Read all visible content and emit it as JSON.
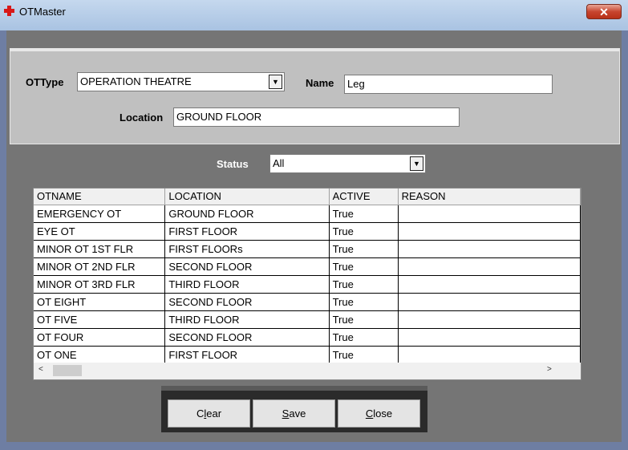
{
  "window": {
    "title": "OTMaster",
    "close_label": "✕"
  },
  "form": {
    "ottype_label": "OTType",
    "ottype_value": "OPERATION THEATRE",
    "name_label": "Name",
    "name_value": "Leg",
    "location_label": "Location",
    "location_value": "GROUND FLOOR",
    "status_label": "Status",
    "status_value": "All"
  },
  "grid": {
    "columns": [
      "OTNAME",
      "LOCATION",
      "ACTIVE",
      "REASON"
    ],
    "rows": [
      [
        "EMERGENCY OT",
        "GROUND FLOOR",
        "True",
        ""
      ],
      [
        "EYE OT",
        "FIRST FLOOR",
        "True",
        ""
      ],
      [
        "MINOR OT 1ST FLR",
        "FIRST FLOORs",
        "True",
        ""
      ],
      [
        "MINOR OT 2ND FLR",
        "SECOND FLOOR",
        "True",
        ""
      ],
      [
        "MINOR OT 3RD FLR",
        "THIRD FLOOR",
        "True",
        ""
      ],
      [
        "OT EIGHT",
        "SECOND FLOOR",
        "True",
        ""
      ],
      [
        "OT FIVE",
        "THIRD FLOOR",
        "True",
        ""
      ],
      [
        "OT FOUR",
        "SECOND FLOOR",
        "True",
        ""
      ],
      [
        "OT ONE",
        "FIRST FLOOR",
        "True",
        ""
      ]
    ]
  },
  "buttons": {
    "clear": {
      "pre": "C",
      "u": "l",
      "post": "ear"
    },
    "save": {
      "pre": "",
      "u": "S",
      "post": "ave"
    },
    "close": {
      "pre": "",
      "u": "C",
      "post": "lose"
    }
  },
  "icons": {
    "app": "red-cross-icon",
    "dropdown": "chevron-down-icon"
  }
}
